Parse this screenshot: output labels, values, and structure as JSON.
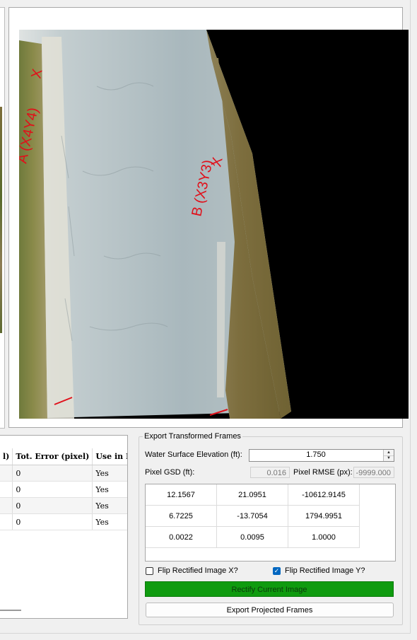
{
  "image_annotations": {
    "point_a": "A (X4Y4)",
    "point_b": "B (X3Y3)",
    "marker": "X"
  },
  "table": {
    "headers": [
      "l)",
      "Tot. Error (pixel)",
      "Use in Recti"
    ],
    "rows": [
      [
        "",
        "0",
        "Yes"
      ],
      [
        "",
        "0",
        "Yes"
      ],
      [
        "",
        "0",
        "Yes"
      ],
      [
        "",
        "0",
        "Yes"
      ]
    ]
  },
  "export": {
    "group_title": "Export Transformed Frames",
    "wse_label": "Water Surface Elevation (ft):",
    "wse_value": "1.750",
    "gsd_label": "Pixel GSD (ft):",
    "gsd_value": "0.016",
    "rmse_label": "Pixel RMSE (px):",
    "rmse_value": "-9999.000",
    "matrix": [
      [
        "12.1567",
        "21.0951",
        "-10612.9145"
      ],
      [
        "6.7225",
        "-13.7054",
        "1794.9951"
      ],
      [
        "0.0022",
        "0.0095",
        "1.0000"
      ]
    ],
    "flip_x_label": "Flip Rectified Image X?",
    "flip_x_checked": false,
    "flip_y_label": "Flip Rectified Image Y?",
    "flip_y_checked": true,
    "rectify_button": "Rectify Current Image",
    "export_button": "Export Projected Frames"
  }
}
